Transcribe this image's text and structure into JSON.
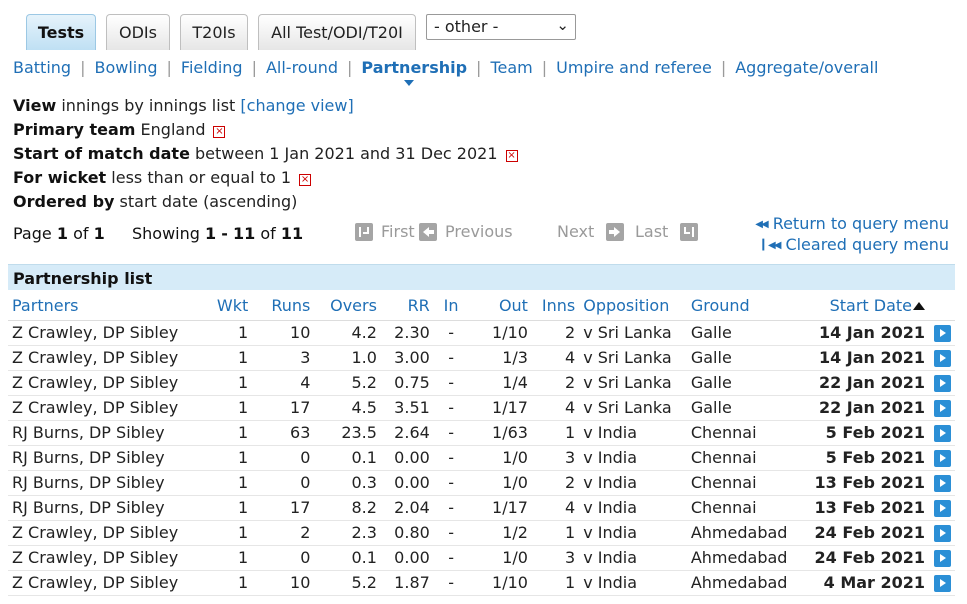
{
  "tabs": [
    {
      "label": "Tests",
      "active": true
    },
    {
      "label": "ODIs",
      "active": false
    },
    {
      "label": "T20Is",
      "active": false
    },
    {
      "label": "All Test/ODI/T20I",
      "active": false
    }
  ],
  "other_select": {
    "value": "- other -"
  },
  "nav": [
    {
      "label": "Batting"
    },
    {
      "label": "Bowling"
    },
    {
      "label": "Fielding"
    },
    {
      "label": "All-round"
    },
    {
      "label": "Partnership",
      "active": true
    },
    {
      "label": "Team"
    },
    {
      "label": "Umpire and referee"
    },
    {
      "label": "Aggregate/overall"
    }
  ],
  "criteria": {
    "view_label": "View",
    "view_value": "innings by innings list",
    "change_view": "[change view]",
    "primary_team_label": "Primary team",
    "primary_team_value": "England",
    "start_date_label": "Start of match date",
    "start_date_value": "between 1 Jan 2021 and 31 Dec 2021",
    "wicket_label": "For wicket",
    "wicket_value": "less than or equal to 1",
    "ordered_label": "Ordered by",
    "ordered_value": "start date (ascending)"
  },
  "paging": {
    "page_word": "Page",
    "page": "1",
    "of_word": "of",
    "pages": "1",
    "showing_word": "Showing",
    "from": "1",
    "dash": "-",
    "to": "11",
    "of_word2": "of",
    "total": "11",
    "first": "First",
    "previous": "Previous",
    "next": "Next",
    "last": "Last"
  },
  "query_links": {
    "return": "Return to query menu",
    "cleared": "Cleared query menu"
  },
  "table": {
    "title": "Partnership list",
    "columns": [
      "Partners",
      "Wkt",
      "Runs",
      "Overs",
      "RR",
      "In",
      "Out",
      "Inns",
      "Opposition",
      "Ground",
      "Start Date"
    ],
    "rows": [
      {
        "partners": "Z Crawley, DP Sibley",
        "wkt": "1",
        "runs": "10",
        "overs": "4.2",
        "rr": "2.30",
        "in": "-",
        "out": "1/10",
        "inns": "2",
        "opposition": "v Sri Lanka",
        "ground": "Galle",
        "date": "14 Jan 2021"
      },
      {
        "partners": "Z Crawley, DP Sibley",
        "wkt": "1",
        "runs": "3",
        "overs": "1.0",
        "rr": "3.00",
        "in": "-",
        "out": "1/3",
        "inns": "4",
        "opposition": "v Sri Lanka",
        "ground": "Galle",
        "date": "14 Jan 2021"
      },
      {
        "partners": "Z Crawley, DP Sibley",
        "wkt": "1",
        "runs": "4",
        "overs": "5.2",
        "rr": "0.75",
        "in": "-",
        "out": "1/4",
        "inns": "2",
        "opposition": "v Sri Lanka",
        "ground": "Galle",
        "date": "22 Jan 2021"
      },
      {
        "partners": "Z Crawley, DP Sibley",
        "wkt": "1",
        "runs": "17",
        "overs": "4.5",
        "rr": "3.51",
        "in": "-",
        "out": "1/17",
        "inns": "4",
        "opposition": "v Sri Lanka",
        "ground": "Galle",
        "date": "22 Jan 2021"
      },
      {
        "partners": "RJ Burns, DP Sibley",
        "wkt": "1",
        "runs": "63",
        "overs": "23.5",
        "rr": "2.64",
        "in": "-",
        "out": "1/63",
        "inns": "1",
        "opposition": "v India",
        "ground": "Chennai",
        "date": "5 Feb 2021"
      },
      {
        "partners": "RJ Burns, DP Sibley",
        "wkt": "1",
        "runs": "0",
        "overs": "0.1",
        "rr": "0.00",
        "in": "-",
        "out": "1/0",
        "inns": "3",
        "opposition": "v India",
        "ground": "Chennai",
        "date": "5 Feb 2021"
      },
      {
        "partners": "RJ Burns, DP Sibley",
        "wkt": "1",
        "runs": "0",
        "overs": "0.3",
        "rr": "0.00",
        "in": "-",
        "out": "1/0",
        "inns": "2",
        "opposition": "v India",
        "ground": "Chennai",
        "date": "13 Feb 2021"
      },
      {
        "partners": "RJ Burns, DP Sibley",
        "wkt": "1",
        "runs": "17",
        "overs": "8.2",
        "rr": "2.04",
        "in": "-",
        "out": "1/17",
        "inns": "4",
        "opposition": "v India",
        "ground": "Chennai",
        "date": "13 Feb 2021"
      },
      {
        "partners": "Z Crawley, DP Sibley",
        "wkt": "1",
        "runs": "2",
        "overs": "2.3",
        "rr": "0.80",
        "in": "-",
        "out": "1/2",
        "inns": "1",
        "opposition": "v India",
        "ground": "Ahmedabad",
        "date": "24 Feb 2021"
      },
      {
        "partners": "Z Crawley, DP Sibley",
        "wkt": "1",
        "runs": "0",
        "overs": "0.1",
        "rr": "0.00",
        "in": "-",
        "out": "1/0",
        "inns": "3",
        "opposition": "v India",
        "ground": "Ahmedabad",
        "date": "24 Feb 2021"
      },
      {
        "partners": "Z Crawley, DP Sibley",
        "wkt": "1",
        "runs": "10",
        "overs": "5.2",
        "rr": "1.87",
        "in": "-",
        "out": "1/10",
        "inns": "1",
        "opposition": "v India",
        "ground": "Ahmedabad",
        "date": "4 Mar 2021"
      }
    ]
  },
  "colors": {
    "link": "#1f6fb6",
    "list_header_bg": "#d6ebf8",
    "play_button": "#2b8fd6"
  }
}
